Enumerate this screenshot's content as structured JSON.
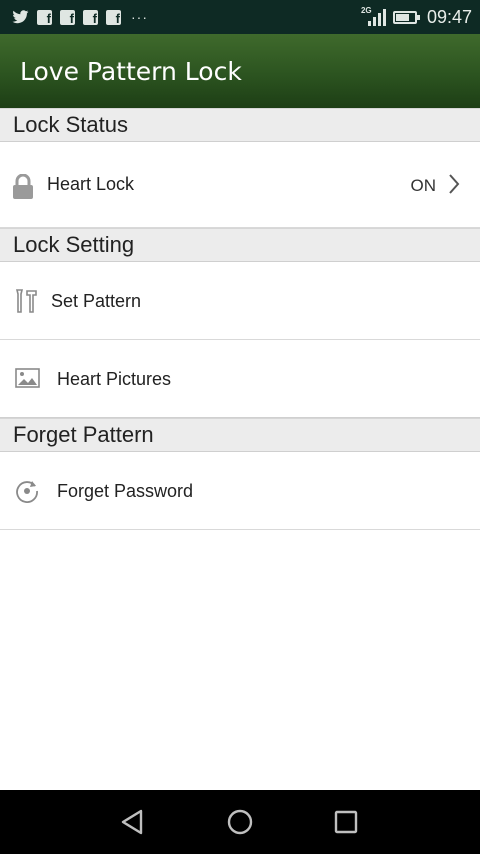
{
  "status_bar": {
    "time": "09:47",
    "network": "2G",
    "battery_level": 0.7,
    "notification_icons": [
      "twitter-icon",
      "facebook-icon",
      "facebook-icon",
      "facebook-icon",
      "facebook-icon",
      "more-icon"
    ],
    "more": "···"
  },
  "app_bar": {
    "title": "Love Pattern Lock",
    "gradient": [
      "#3f6a2c",
      "#1d3e15"
    ]
  },
  "sections": {
    "lock_status": {
      "title": "Lock Status",
      "items": [
        {
          "label": "Heart Lock",
          "value": "ON",
          "icon": "padlock-icon"
        }
      ]
    },
    "lock_setting": {
      "title": "Lock Setting",
      "items": [
        {
          "label": "Set Pattern",
          "icon": "tools-icon"
        },
        {
          "label": "Heart Pictures",
          "icon": "picture-icon"
        }
      ]
    },
    "forget_pattern": {
      "title": "Forget Pattern",
      "items": [
        {
          "label": "Forget Password",
          "icon": "refresh-icon"
        }
      ]
    }
  },
  "nav_bar": {
    "buttons": [
      "back-icon",
      "home-icon",
      "recents-icon"
    ]
  }
}
